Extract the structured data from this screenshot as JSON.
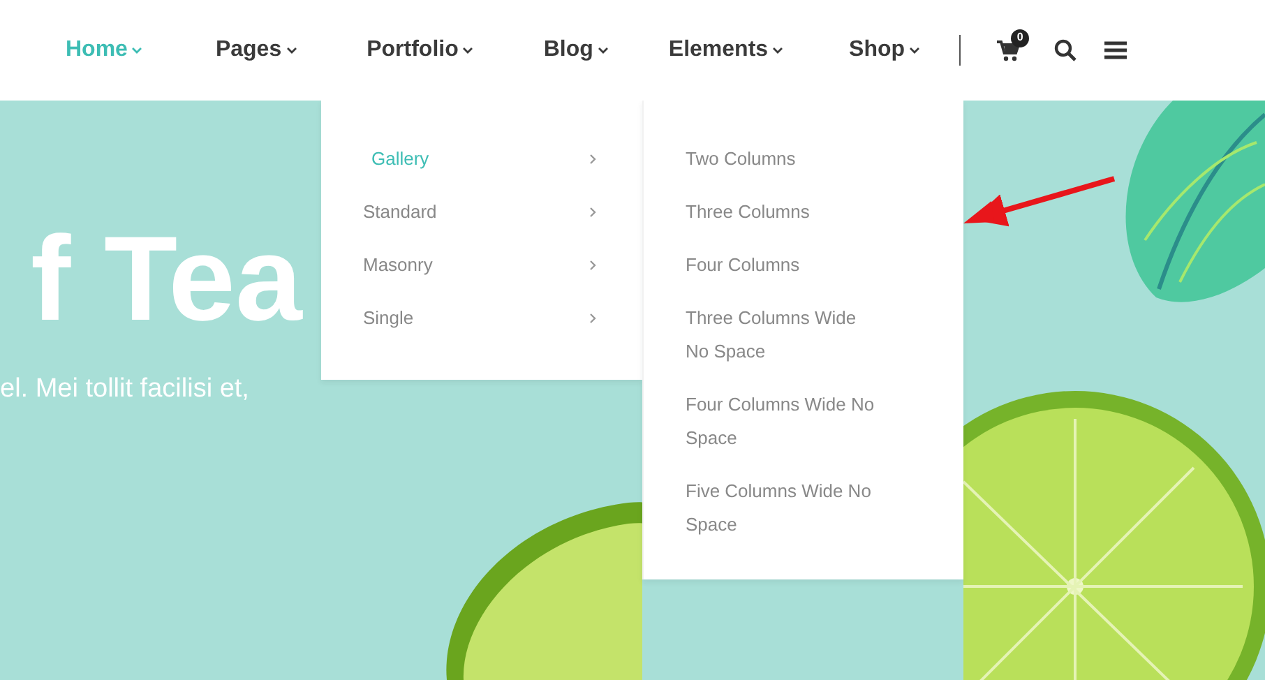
{
  "nav": {
    "items": [
      {
        "label": "Home",
        "selected": true
      },
      {
        "label": "Pages",
        "selected": false
      },
      {
        "label": "Portfolio",
        "selected": false
      },
      {
        "label": "Blog",
        "selected": false
      },
      {
        "label": "Elements",
        "selected": false
      },
      {
        "label": "Shop",
        "selected": false
      }
    ],
    "cart_count": "0"
  },
  "hero": {
    "title": "f Tea",
    "text": "el. Mei tollit facilisi et,"
  },
  "menu": {
    "items": [
      {
        "label": "Gallery",
        "selected": true
      },
      {
        "label": "Standard",
        "selected": false
      },
      {
        "label": "Masonry",
        "selected": false
      },
      {
        "label": "Single",
        "selected": false
      }
    ],
    "submenu": [
      "Two Columns",
      "Three Columns",
      "Four Columns",
      "Three Columns Wide No Space",
      "Four Columns Wide No Space",
      "Five Columns Wide No Space"
    ]
  }
}
